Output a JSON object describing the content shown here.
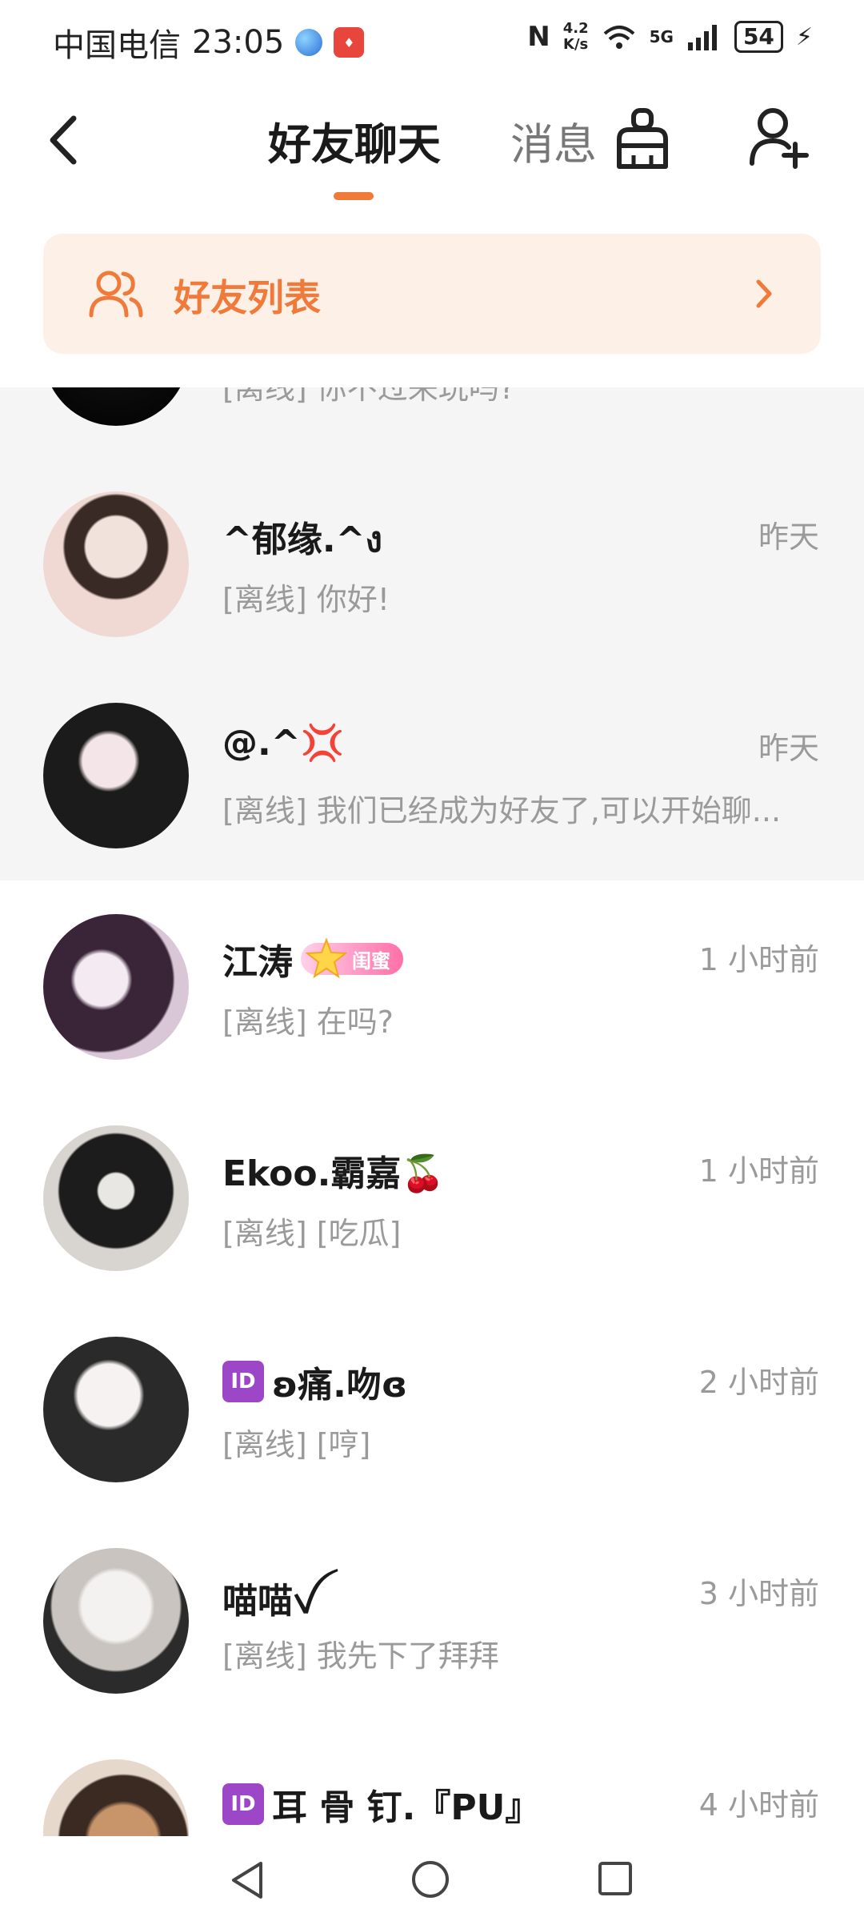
{
  "status_bar": {
    "carrier": "中国电信",
    "time": "23:05",
    "speed_top": "4.2",
    "speed_unit": "K/s",
    "network": "5G",
    "battery": "54"
  },
  "header": {
    "tab_friends": "好友聊天",
    "tab_messages": "消息",
    "back_icon": "chevron-left-icon",
    "clean_icon": "broom-icon",
    "add_icon": "add-friend-icon"
  },
  "banner": {
    "label": "好友列表",
    "icon": "friends-icon"
  },
  "chats": [
    {
      "name": "",
      "preview": "[离线] 你不过来玩吗?",
      "time": ""
    },
    {
      "name": "^郁缘.^ง",
      "preview": "[离线] 你好!",
      "time": "昨天"
    },
    {
      "name": "@.^💢",
      "preview": "[离线] 我们已经成为好友了,可以开始聊...",
      "time": "昨天"
    },
    {
      "name": "江涛",
      "badge": "闺蜜",
      "preview": "[离线] 在吗?",
      "time": "1 小时前"
    },
    {
      "name": "Ekoo.霸嘉🍒",
      "preview": "[离线] [吃瓜]",
      "time": "1 小时前"
    },
    {
      "name": "ʚ痛.吻ɞ",
      "id_icon": "ID",
      "preview": "[离线] [哼]",
      "time": "2 小时前"
    },
    {
      "name": "喵喵ꪜ",
      "preview": "[离线] 我先下了拜拜",
      "time": "3 小时前"
    },
    {
      "name": "耳 骨 钉.『PU』",
      "id_icon": "ID",
      "preview": "",
      "time": "4 小时前"
    }
  ],
  "colors": {
    "accent": "#f07a3a",
    "banner_bg": "#fdf0e7",
    "badge_pink": "#ff6fa8",
    "muted_text": "#9a9a9a",
    "gray_row": "#f5f5f6"
  }
}
